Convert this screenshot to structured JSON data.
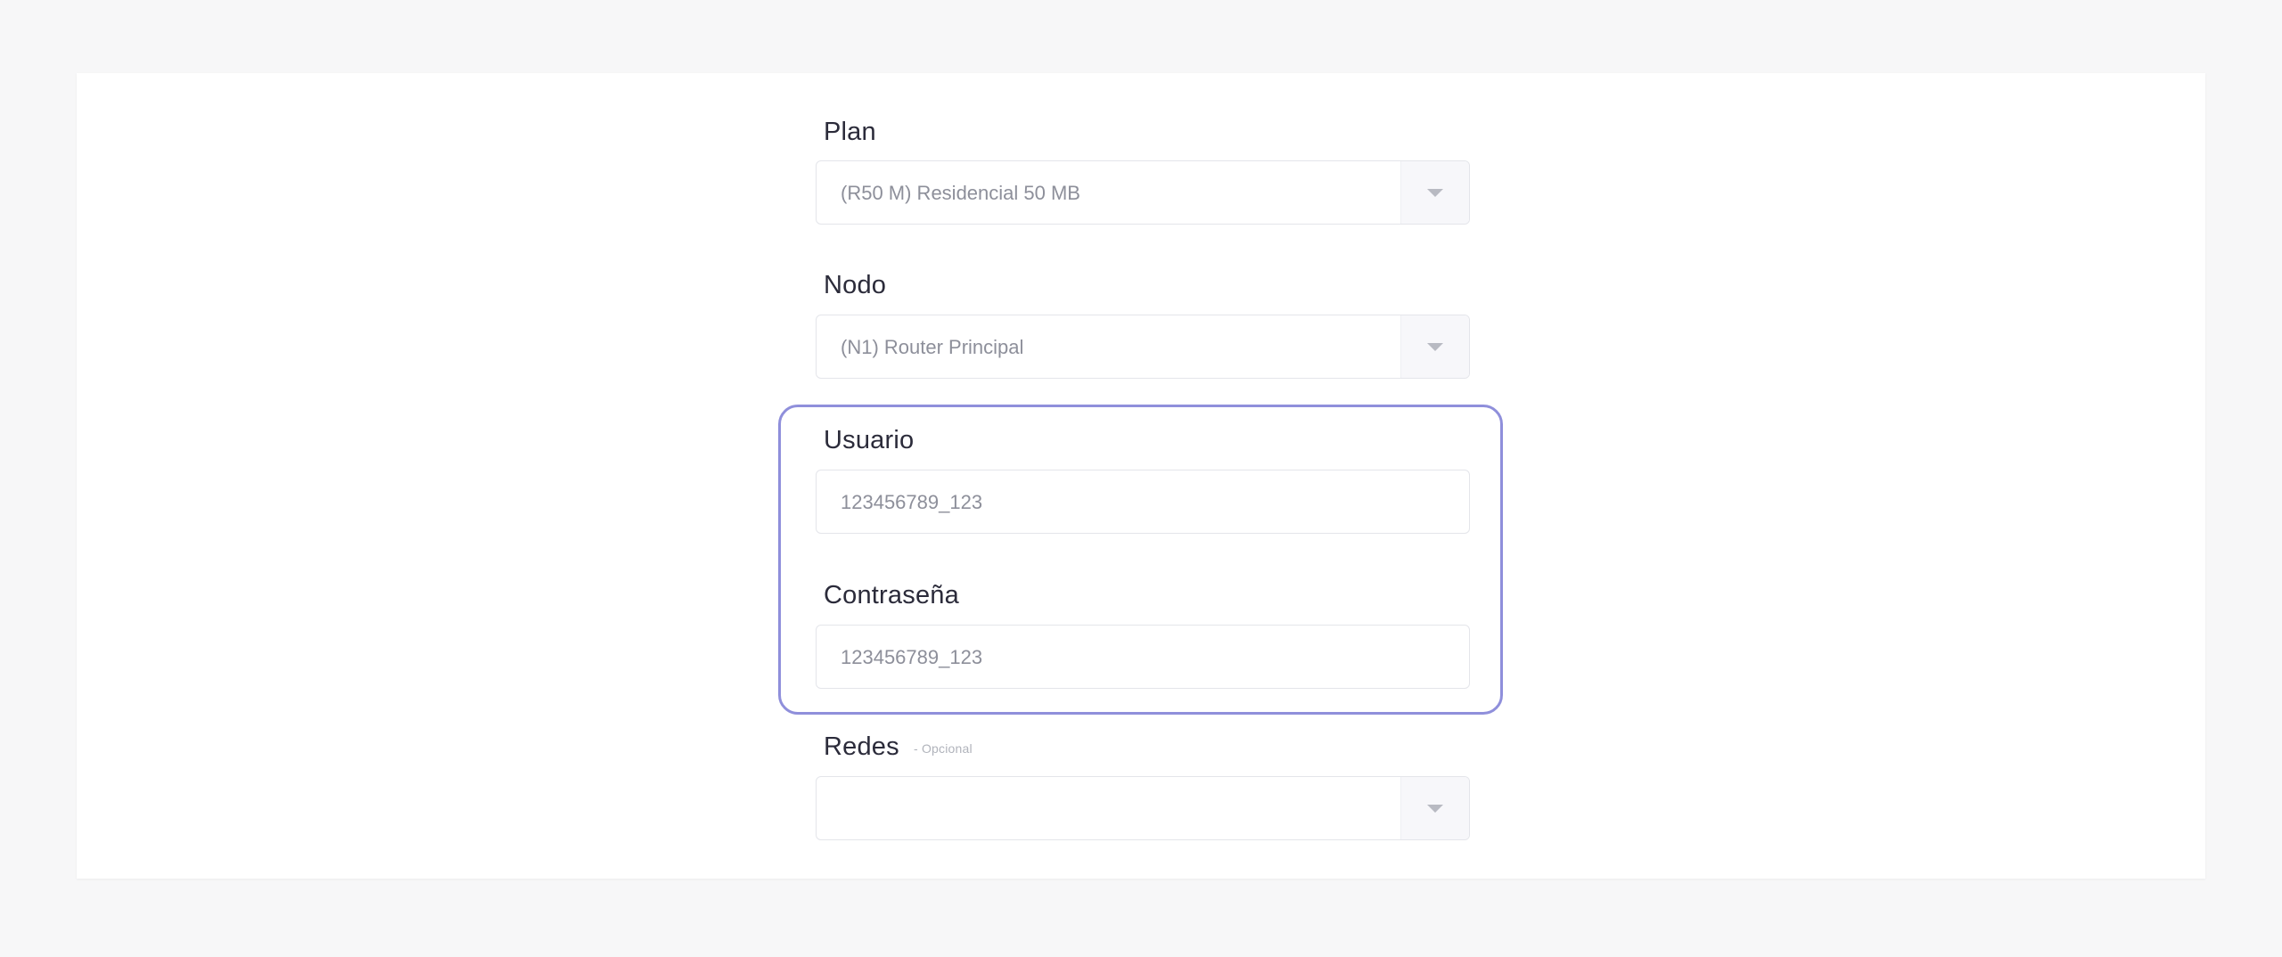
{
  "form": {
    "plan": {
      "label": "Plan",
      "selected": "(R50 M) Residencial 50 MB"
    },
    "nodo": {
      "label": "Nodo",
      "selected": "(N1) Router Principal"
    },
    "usuario": {
      "label": "Usuario",
      "placeholder": "123456789_123"
    },
    "contrasena": {
      "label": "Contraseña",
      "placeholder": "123456789_123"
    },
    "redes": {
      "label": "Redes",
      "optional": "- Opcional",
      "selected": ""
    }
  },
  "colors": {
    "highlight": "#8f8fdb",
    "page_bg": "#f7f7f8",
    "card_bg": "#ffffff"
  }
}
